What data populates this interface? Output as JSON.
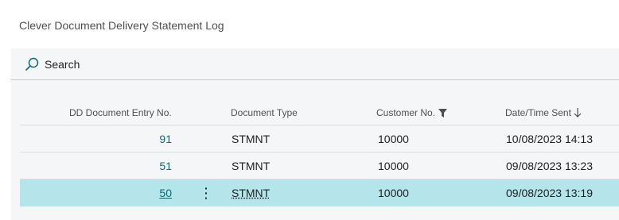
{
  "page": {
    "title": "Clever Document Delivery Statement Log"
  },
  "search": {
    "label": "Search",
    "icon": "search-icon"
  },
  "columns": {
    "entry_no": "DD Document Entry No.",
    "document_type": "Document Type",
    "customer_no": "Customer No.",
    "date_time_sent": "Date/Time Sent"
  },
  "column_state": {
    "customer_no_filter_icon": "filter-icon",
    "date_time_sent_sort_icon": "sort-descending-icon"
  },
  "rows": [
    {
      "entry_no": "91",
      "document_type": "STMNT",
      "customer_no": "10000",
      "date_time_sent": "10/08/2023 14:13",
      "selected": false
    },
    {
      "entry_no": "51",
      "document_type": "STMNT",
      "customer_no": "10000",
      "date_time_sent": "09/08/2023 13:23",
      "selected": false
    },
    {
      "entry_no": "50",
      "document_type": "STMNT",
      "customer_no": "10000",
      "date_time_sent": "09/08/2023 13:19",
      "selected": true,
      "row_menu": "⋮"
    }
  ],
  "colors": {
    "selected_row": "#b3e5ea",
    "link": "#0e6b73"
  }
}
